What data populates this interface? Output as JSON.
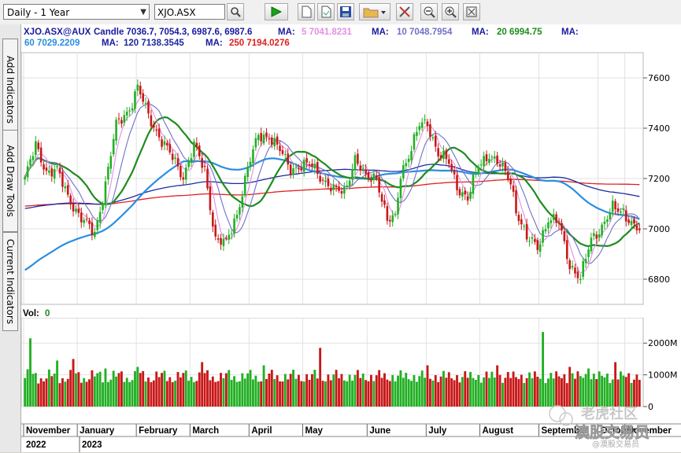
{
  "toolbar": {
    "period_select": "Daily - 1 Year",
    "symbol_value": "XJO.ASX",
    "icons": [
      "search-icon",
      "play-icon",
      "new-page-icon",
      "open-icon",
      "save-icon",
      "folder-icon",
      "dropdown-icon",
      "tools-icon",
      "zoom-out-icon",
      "zoom-in-icon",
      "fit-icon"
    ]
  },
  "side_tabs": {
    "add_indicators": "Add Indicators",
    "add_draw_tools": "Add Draw Tools",
    "current_indicators": "Current Indicators"
  },
  "colors": {
    "candle_up": "#22b024",
    "candle_down": "#c81818",
    "ma5": "#e58ee5",
    "ma10": "#7070c8",
    "ma20": "#1e8c1e",
    "ma60": "#2a8ee0",
    "ma120": "#1c2aa0",
    "ma250": "#e02020"
  },
  "header": {
    "symbol": "XJO.ASX@AUX",
    "ohlc_text": "Candle 7036.7, 7054.3, 6987.6, 6987.6",
    "ma_label": "MA:",
    "ma5": "5 7041.8231",
    "ma10": "10 7048.7954",
    "ma20": "20 6994.75",
    "ma60": "60 7029.2209",
    "ma120": "120 7138.3545",
    "ma250": "250 7194.0276"
  },
  "volume_header": {
    "label": "Vol:",
    "value": "0"
  },
  "watermark": {
    "line1": "老虎社区",
    "line2": "澳股交易员",
    "line3": "@澳股交易员"
  },
  "chart_data": {
    "type": "candlestick",
    "price_axis": {
      "ticks": [
        6800,
        7000,
        7200,
        7400,
        7600
      ],
      "tick_labels": [
        "6800",
        "7000",
        "7200",
        "7400",
        "7600"
      ],
      "range": [
        6700,
        7700
      ]
    },
    "volume_axis": {
      "ticks": [
        0,
        1000,
        2000
      ],
      "tick_labels": [
        "0",
        "1000M",
        "2000M"
      ]
    },
    "x_month_labels": [
      "November",
      "January",
      "February",
      "March",
      "April",
      "May",
      "June",
      "July",
      "August",
      "September",
      "October",
      "November"
    ],
    "x_year_labels": [
      "2022",
      "2023"
    ],
    "price_anchors": [
      [
        0,
        7200
      ],
      [
        4,
        7330
      ],
      [
        8,
        7230
      ],
      [
        12,
        7230
      ],
      [
        16,
        7130
      ],
      [
        21,
        7040
      ],
      [
        26,
        6980
      ],
      [
        30,
        7180
      ],
      [
        34,
        7410
      ],
      [
        39,
        7480
      ],
      [
        42,
        7560
      ],
      [
        46,
        7450
      ],
      [
        51,
        7350
      ],
      [
        55,
        7280
      ],
      [
        59,
        7210
      ],
      [
        63,
        7330
      ],
      [
        67,
        7230
      ],
      [
        71,
        6960
      ],
      [
        75,
        6940
      ],
      [
        79,
        7060
      ],
      [
        83,
        7240
      ],
      [
        87,
        7370
      ],
      [
        91,
        7370
      ],
      [
        95,
        7310
      ],
      [
        99,
        7240
      ],
      [
        103,
        7250
      ],
      [
        107,
        7250
      ],
      [
        111,
        7200
      ],
      [
        115,
        7150
      ],
      [
        119,
        7150
      ],
      [
        123,
        7280
      ],
      [
        127,
        7200
      ],
      [
        131,
        7210
      ],
      [
        135,
        7030
      ],
      [
        138,
        7040
      ],
      [
        140,
        7220
      ],
      [
        144,
        7320
      ],
      [
        147,
        7410
      ],
      [
        150,
        7420
      ],
      [
        154,
        7300
      ],
      [
        158,
        7260
      ],
      [
        161,
        7170
      ],
      [
        165,
        7120
      ],
      [
        169,
        7250
      ],
      [
        173,
        7300
      ],
      [
        177,
        7250
      ],
      [
        181,
        7190
      ],
      [
        183,
        7080
      ],
      [
        187,
        6960
      ],
      [
        191,
        6930
      ],
      [
        195,
        7040
      ],
      [
        199,
        7020
      ],
      [
        203,
        6860
      ],
      [
        207,
        6800
      ],
      [
        211,
        6960
      ],
      [
        215,
        7010
      ],
      [
        219,
        7080
      ],
      [
        223,
        7070
      ],
      [
        227,
        7010
      ],
      [
        229,
        6990
      ]
    ],
    "volume_pattern": [
      900,
      1100,
      850,
      950,
      1050,
      800,
      1000,
      880
    ],
    "volume_spikes": [
      [
        2,
        2150
      ],
      [
        12,
        1450
      ],
      [
        18,
        1500
      ],
      [
        30,
        1200
      ],
      [
        42,
        1250
      ],
      [
        66,
        1400
      ],
      [
        89,
        1300
      ],
      [
        110,
        1850
      ],
      [
        150,
        1300
      ],
      [
        176,
        1300
      ],
      [
        193,
        2350
      ],
      [
        203,
        1250
      ],
      [
        210,
        1200
      ],
      [
        220,
        1400
      ]
    ],
    "months_on_axis": 12,
    "bars": 230
  }
}
